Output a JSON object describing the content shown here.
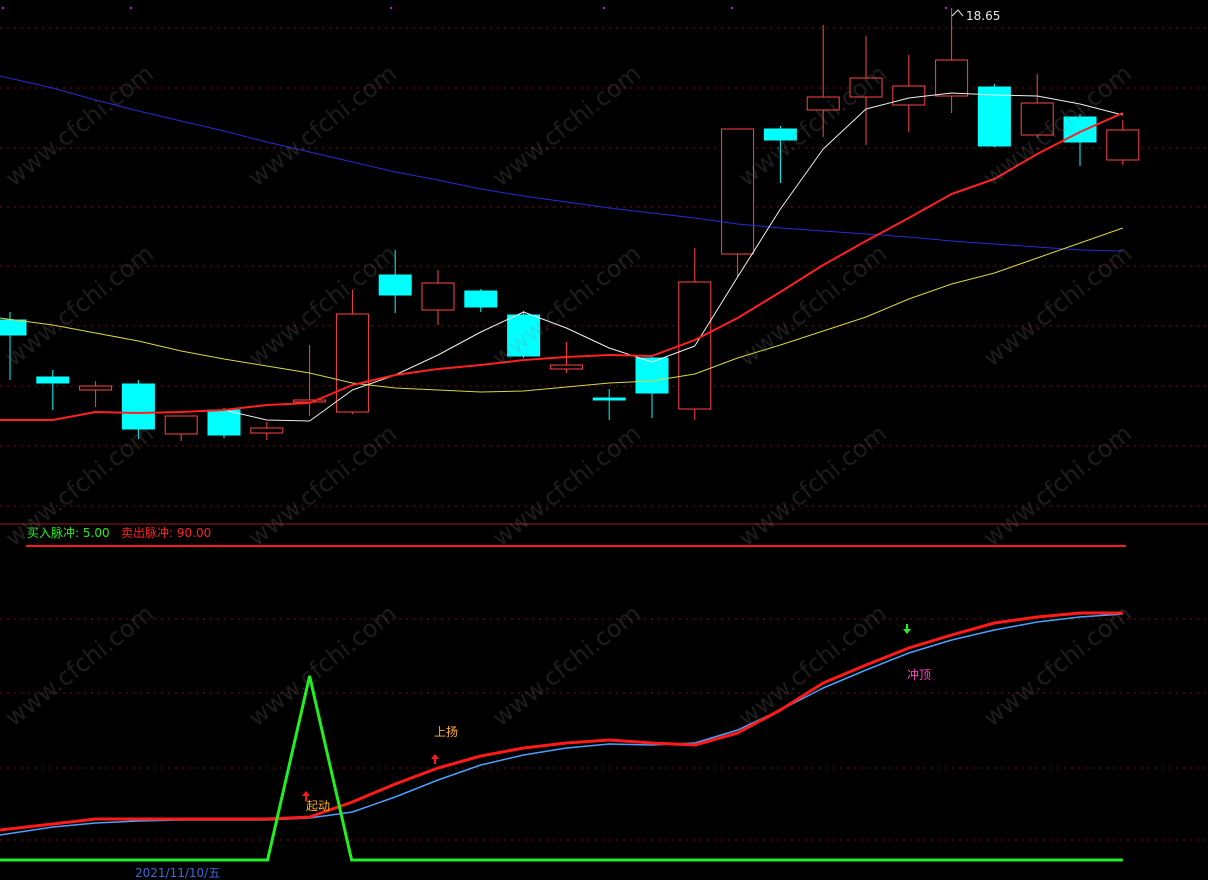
{
  "colors": {
    "up": "#ff4444",
    "down": "#00ffff",
    "ma_white": "#f0f0f0",
    "ma_red": "#ff2020",
    "ma_yellow": "#d8d840",
    "ma_blue": "#2a2ad8",
    "grid": "#7a1010",
    "osc_red": "#ff1a1a",
    "osc_blue": "#4aa0ff",
    "osc_green": "#22ee22",
    "buy_text": "#22ee22",
    "sell_text": "#ff2020",
    "label_orange": "#ffb020",
    "label_magenta": "#ff40c0"
  },
  "price_panel": {
    "high_marker": "18.65",
    "candles": [
      {
        "dir": "down",
        "open": 320,
        "close": 335,
        "high": 312,
        "low": 380
      },
      {
        "dir": "down",
        "open": 377,
        "close": 383,
        "high": 370,
        "low": 410
      },
      {
        "dir": "up",
        "open": 390,
        "close": 386,
        "high": 381,
        "low": 407
      },
      {
        "dir": "down",
        "open": 384,
        "close": 429,
        "high": 380,
        "low": 439
      },
      {
        "dir": "up",
        "open": 434,
        "close": 416,
        "high": 416,
        "low": 441
      },
      {
        "dir": "down",
        "open": 410,
        "close": 435,
        "high": 408,
        "low": 438
      },
      {
        "dir": "up",
        "open": 433,
        "close": 428,
        "high": 422,
        "low": 440
      },
      {
        "dir": "up",
        "open": 402,
        "close": 400,
        "high": 345,
        "low": 416
      },
      {
        "dir": "up",
        "open": 412,
        "close": 314,
        "high": 290,
        "low": 414
      },
      {
        "dir": "down",
        "open": 275,
        "close": 295,
        "high": 250,
        "low": 313
      },
      {
        "dir": "up",
        "open": 310,
        "close": 283,
        "high": 270,
        "low": 325
      },
      {
        "dir": "down",
        "open": 291,
        "close": 307,
        "high": 289,
        "low": 312
      },
      {
        "dir": "down",
        "open": 315,
        "close": 356,
        "high": 311,
        "low": 358
      },
      {
        "dir": "up",
        "open": 369,
        "close": 365,
        "high": 342,
        "low": 373
      },
      {
        "dir": "down",
        "open": 398,
        "close": 400,
        "high": 389,
        "low": 420
      },
      {
        "dir": "down",
        "open": 358,
        "close": 393,
        "high": 355,
        "low": 418
      },
      {
        "dir": "up",
        "open": 409,
        "close": 282,
        "high": 248,
        "low": 420
      },
      {
        "dir": "up",
        "open": 254,
        "close": 129,
        "high": 129,
        "low": 277
      },
      {
        "dir": "down",
        "open": 129,
        "close": 140,
        "high": 126,
        "low": 183
      },
      {
        "dir": "up",
        "open": 110,
        "close": 97,
        "high": 25,
        "low": 137
      },
      {
        "dir": "up",
        "open": 97,
        "close": 78,
        "high": 36,
        "low": 145
      },
      {
        "dir": "up",
        "open": 105,
        "close": 86,
        "high": 55,
        "low": 132
      },
      {
        "dir": "up",
        "open": 96,
        "close": 60,
        "high": 8,
        "low": 113
      },
      {
        "dir": "down",
        "open": 87,
        "close": 146,
        "high": 84,
        "low": 147
      },
      {
        "dir": "up",
        "open": 135,
        "close": 103,
        "high": 74,
        "low": 138
      },
      {
        "dir": "down",
        "open": 117,
        "close": 142,
        "high": 114,
        "low": 166
      },
      {
        "dir": "up",
        "open": 160,
        "close": 130,
        "high": 120,
        "low": 165
      }
    ],
    "ma_white": [
      null,
      null,
      null,
      null,
      null,
      410,
      420,
      421,
      390,
      375,
      355,
      332,
      312,
      328,
      348,
      362,
      346,
      277,
      209,
      149,
      109,
      98,
      93,
      95,
      96,
      104,
      115
    ],
    "ma_red": [
      420,
      420,
      412,
      413,
      412,
      410,
      405,
      403,
      385,
      375,
      369,
      365,
      360,
      357,
      355,
      356,
      340,
      318,
      292,
      265,
      241,
      218,
      194,
      179,
      154,
      132,
      113
    ],
    "ma_yellow": [
      318,
      325,
      333,
      341,
      351,
      359,
      366,
      373,
      383,
      388,
      390,
      392,
      391,
      387,
      383,
      381,
      374,
      358,
      345,
      331,
      317,
      299,
      284,
      273,
      258,
      243,
      228
    ],
    "ma_blue": [
      76,
      88,
      100,
      111,
      121,
      131,
      142,
      152,
      162,
      172,
      180,
      189,
      196,
      202,
      208,
      213,
      218,
      224,
      228,
      231,
      234,
      237,
      241,
      244,
      247,
      250,
      251
    ]
  },
  "osc_panel": {
    "legend_buy_label": "买入脉冲:",
    "legend_buy_value": "5.00",
    "legend_sell_label": "卖出脉冲:",
    "legend_sell_value": "90.00",
    "label_start": "起动",
    "label_rise": "上扬",
    "label_top": "冲顶",
    "red_line": [
      830,
      824,
      819,
      819,
      819,
      819,
      819,
      817,
      802,
      784,
      768,
      756,
      748,
      743,
      740,
      743,
      745,
      733,
      710,
      683,
      665,
      648,
      635,
      623,
      617,
      613,
      613
    ],
    "blue_line": [
      835,
      827,
      823,
      821,
      820,
      820,
      820,
      818,
      812,
      797,
      780,
      765,
      755,
      748,
      744,
      745,
      743,
      730,
      710,
      688,
      670,
      653,
      640,
      630,
      622,
      617,
      614
    ],
    "green_pulse": [
      860,
      860,
      860,
      860,
      860,
      860,
      860,
      676,
      860,
      860,
      860,
      860,
      860,
      860,
      860,
      860,
      860,
      860,
      860,
      860,
      860,
      860,
      860,
      860,
      860,
      860,
      860
    ]
  },
  "bottom_bar": {
    "date_text": "2021/11/10/五"
  },
  "watermark": "www.cfchi.com"
}
